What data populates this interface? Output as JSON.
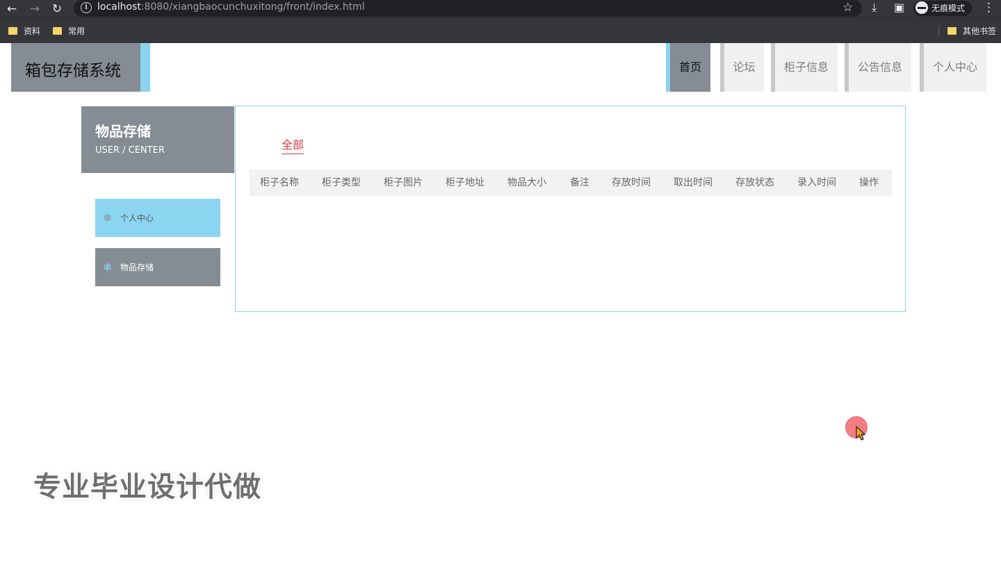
{
  "browser": {
    "url_host": "localhost",
    "url_rest": ":8080/xiangbaocunchuxitong/front/index.html",
    "incognito_label": "无痕模式",
    "bookmarks": [
      "资料",
      "常用"
    ],
    "other_bookmarks": "其他书签",
    "icons": {
      "back": "←",
      "forward": "→",
      "reload": "↻",
      "star": "☆",
      "download": "⤓",
      "sidepanel": "▣",
      "menu": "⋮",
      "info": "i"
    }
  },
  "header": {
    "logo": "箱包存储系统",
    "nav": [
      "首页",
      "论坛",
      "柜子信息",
      "公告信息",
      "个人中心"
    ],
    "active_nav": "首页"
  },
  "sidebar": {
    "title": "物品存储",
    "subtitle": "USER / CENTER",
    "items": [
      {
        "label": "个人中心",
        "icon": "❄"
      },
      {
        "label": "物品存储",
        "icon": "❄"
      }
    ]
  },
  "main": {
    "tab": "全部",
    "columns": [
      "柜子名称",
      "柜子类型",
      "柜子图片",
      "柜子地址",
      "物品大小",
      "备注",
      "存放时间",
      "取出时间",
      "存放状态",
      "录入时间",
      "操作"
    ]
  },
  "watermark": "专业毕业设计代做",
  "colors": {
    "accent_blue": "#8cd3ef",
    "gray_block": "#858c93",
    "tab_red": "#d7373f"
  }
}
